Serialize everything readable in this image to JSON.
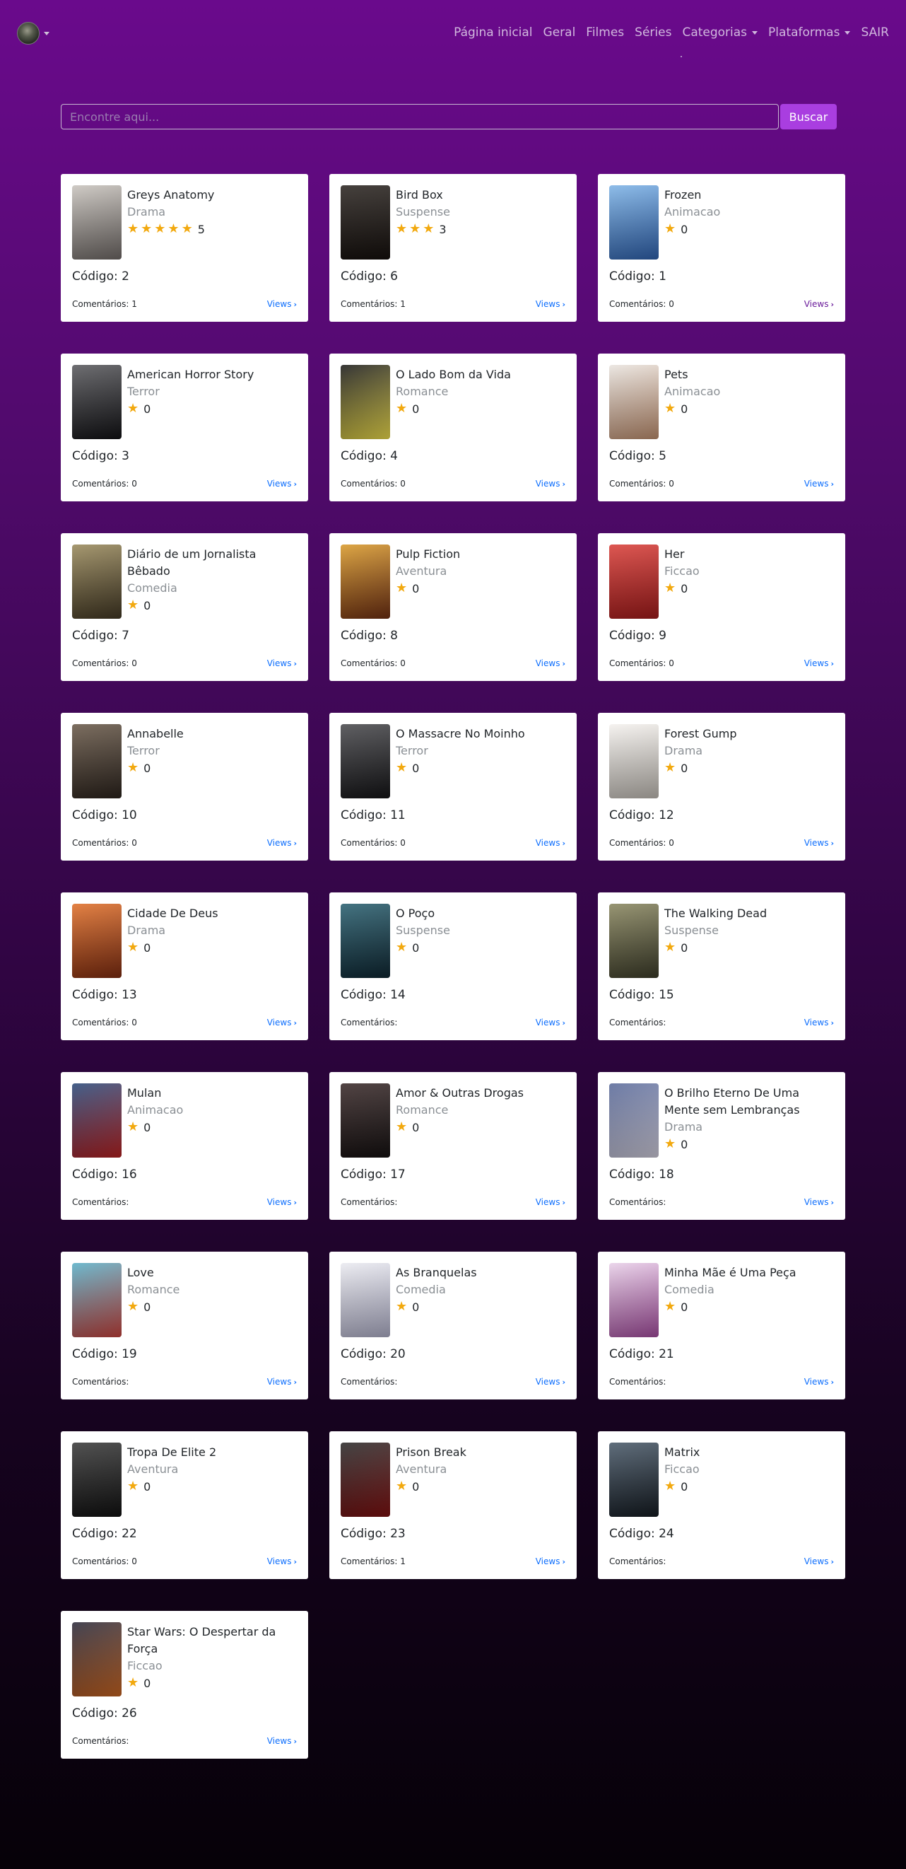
{
  "nav": {
    "links": [
      "Página inicial",
      "Geral",
      "Filmes",
      "Séries",
      "Categorias",
      "Plataformas",
      "SAIR"
    ],
    "dropdowns": [
      false,
      false,
      false,
      false,
      true,
      true,
      false
    ]
  },
  "search": {
    "placeholder": "Encontre aqui...",
    "button": "Buscar"
  },
  "labels": {
    "code_prefix": "Código: ",
    "comments_prefix": "Comentários: ",
    "views": "Views"
  },
  "colors": {
    "background_top": "#6a0a8c",
    "background_bottom": "#060108",
    "accent": "#a93ee0",
    "star": "#f2a90f",
    "link": "#0d6efd"
  },
  "items": [
    {
      "title": "Greys Anatomy",
      "category": "Drama",
      "stars": 5,
      "rating": "5",
      "code": "2",
      "comments": "1",
      "poster": [
        "#c9c4be",
        "#6b6562"
      ]
    },
    {
      "title": "Bird Box",
      "category": "Suspense",
      "stars": 3,
      "rating": "3",
      "code": "6",
      "comments": "1",
      "poster": [
        "#2c2622",
        "#140f0c"
      ]
    },
    {
      "title": "Frozen",
      "category": "Animacao",
      "stars": 1,
      "rating": "0",
      "code": "1",
      "comments": "0",
      "poster": [
        "#7fb4e6",
        "#2d5ea8"
      ],
      "visited": true
    },
    {
      "title": "American Horror Story",
      "category": "Terror",
      "stars": 1,
      "rating": "0",
      "code": "3",
      "comments": "0",
      "poster": [
        "#5a5a5e",
        "#111114"
      ]
    },
    {
      "title": "O Lado Bom da Vida",
      "category": "Romance",
      "stars": 1,
      "rating": "0",
      "code": "4",
      "comments": "0",
      "poster": [
        "#1a1a1a",
        "#e6d64a"
      ]
    },
    {
      "title": "Pets",
      "category": "Animacao",
      "stars": 1,
      "rating": "0",
      "code": "5",
      "comments": "0",
      "poster": [
        "#e9e4df",
        "#b8896a"
      ]
    },
    {
      "title": "Diário de um Jornalista Bêbado",
      "category": "Comedia",
      "stars": 1,
      "rating": "0",
      "code": "7",
      "comments": "0",
      "poster": [
        "#9a8a5c",
        "#3f3522"
      ]
    },
    {
      "title": "Pulp Fiction",
      "category": "Aventura",
      "stars": 1,
      "rating": "0",
      "code": "8",
      "comments": "0",
      "poster": [
        "#d99a2b",
        "#6b2d12"
      ]
    },
    {
      "title": "Her",
      "category": "Ficcao",
      "stars": 1,
      "rating": "0",
      "code": "9",
      "comments": "0",
      "poster": [
        "#d9403a",
        "#9c1a1a"
      ]
    },
    {
      "title": "Annabelle",
      "category": "Terror",
      "stars": 1,
      "rating": "0",
      "code": "10",
      "comments": "0",
      "poster": [
        "#6a5a4a",
        "#2a221c"
      ]
    },
    {
      "title": "O Massacre No Moinho",
      "category": "Terror",
      "stars": 1,
      "rating": "0",
      "code": "11",
      "comments": "0",
      "poster": [
        "#4a4a4e",
        "#141416"
      ]
    },
    {
      "title": "Forest Gump",
      "category": "Drama",
      "stars": 1,
      "rating": "0",
      "code": "12",
      "comments": "0",
      "poster": [
        "#f4f1ee",
        "#b9b4ad"
      ]
    },
    {
      "title": "Cidade De Deus",
      "category": "Drama",
      "stars": 1,
      "rating": "0",
      "code": "13",
      "comments": "0",
      "poster": [
        "#e0702a",
        "#7a2a10"
      ]
    },
    {
      "title": "O Poço",
      "category": "Suspense",
      "stars": 1,
      "rating": "0",
      "code": "14",
      "comments": "",
      "poster": [
        "#2a6070",
        "#0e2530"
      ]
    },
    {
      "title": "The Walking Dead",
      "category": "Suspense",
      "stars": 1,
      "rating": "0",
      "code": "15",
      "comments": "",
      "poster": [
        "#8a8760",
        "#3a3a28"
      ]
    },
    {
      "title": "Mulan",
      "category": "Animacao",
      "stars": 1,
      "rating": "0",
      "code": "16",
      "comments": "",
      "poster": [
        "#2a4a7a",
        "#b02020"
      ]
    },
    {
      "title": "Amor & Outras Drogas",
      "category": "Romance",
      "stars": 1,
      "rating": "0",
      "code": "17",
      "comments": "",
      "poster": [
        "#3a2a2a",
        "#141010"
      ]
    },
    {
      "title": "O Brilho Eterno De Uma Mente sem Lembranças",
      "category": "Drama",
      "stars": 1,
      "rating": "0",
      "code": "18",
      "comments": "",
      "poster": [
        "#5a6a9a",
        "#c9c6d4"
      ]
    },
    {
      "title": "Love",
      "category": "Romance",
      "stars": 1,
      "rating": "0",
      "code": "19",
      "comments": "",
      "poster": [
        "#5ab0c8",
        "#c0403a"
      ]
    },
    {
      "title": "As Branquelas",
      "category": "Comedia",
      "stars": 1,
      "rating": "0",
      "code": "20",
      "comments": "",
      "poster": [
        "#eaeaf0",
        "#a8a8c0"
      ]
    },
    {
      "title": "Minha Mãe é Uma Peça",
      "category": "Comedia",
      "stars": 1,
      "rating": "0",
      "code": "21",
      "comments": "",
      "poster": [
        "#e8d0e8",
        "#a04a9a"
      ]
    },
    {
      "title": "Tropa De Elite 2",
      "category": "Aventura",
      "stars": 1,
      "rating": "0",
      "code": "22",
      "comments": "0",
      "poster": [
        "#3a3a3a",
        "#101010"
      ]
    },
    {
      "title": "Prison Break",
      "category": "Aventura",
      "stars": 1,
      "rating": "0",
      "code": "23",
      "comments": "1",
      "poster": [
        "#2a2a2a",
        "#7a1010"
      ]
    },
    {
      "title": "Matrix",
      "category": "Ficcao",
      "stars": 1,
      "rating": "0",
      "code": "24",
      "comments": "",
      "poster": [
        "#4a5a6a",
        "#141a20"
      ]
    },
    {
      "title": "Star Wars: O Despertar da Força",
      "category": "Ficcao",
      "stars": 1,
      "rating": "0",
      "code": "26",
      "comments": "",
      "poster": [
        "#2a2a3a",
        "#c06020"
      ]
    }
  ]
}
